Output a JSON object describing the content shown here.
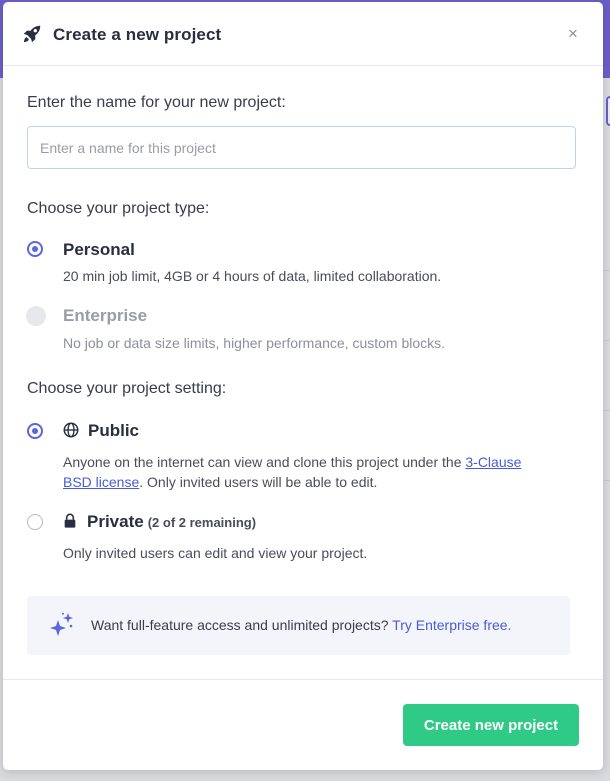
{
  "modal": {
    "title": "Create a new project",
    "close_label": "×"
  },
  "name_section": {
    "label": "Enter the name for your new project:",
    "input_value": "",
    "input_placeholder": "Enter a name for this project"
  },
  "type_section": {
    "label": "Choose your project type:",
    "options": [
      {
        "title": "Personal",
        "description": "20 min job limit, 4GB or 4 hours of data, limited collaboration.",
        "selected": true,
        "disabled": false
      },
      {
        "title": "Enterprise",
        "description": "No job or data size limits, higher performance, custom blocks.",
        "selected": false,
        "disabled": true
      }
    ]
  },
  "setting_section": {
    "label": "Choose your project setting:",
    "public": {
      "title": "Public",
      "icon": "globe-icon",
      "selected": true,
      "description_before": "Anyone on the internet can view and clone this project under the ",
      "license_link": "3-Clause BSD license",
      "description_after": ". Only invited users will be able to edit."
    },
    "private": {
      "title": "Private",
      "icon": "lock-icon",
      "remaining_note": "(2 of 2 remaining)",
      "selected": false,
      "description": "Only invited users can edit and view your project."
    }
  },
  "promo": {
    "icon": "sparkle-icon",
    "text": "Want full-feature access and unlimited projects?",
    "link": "Try Enterprise free."
  },
  "footer": {
    "create_button": "Create new project"
  },
  "colors": {
    "accent": "#5b66dd",
    "primary_button": "#2fcb86",
    "link": "#4a5bd6",
    "header_bar": "#6a5fc9"
  }
}
